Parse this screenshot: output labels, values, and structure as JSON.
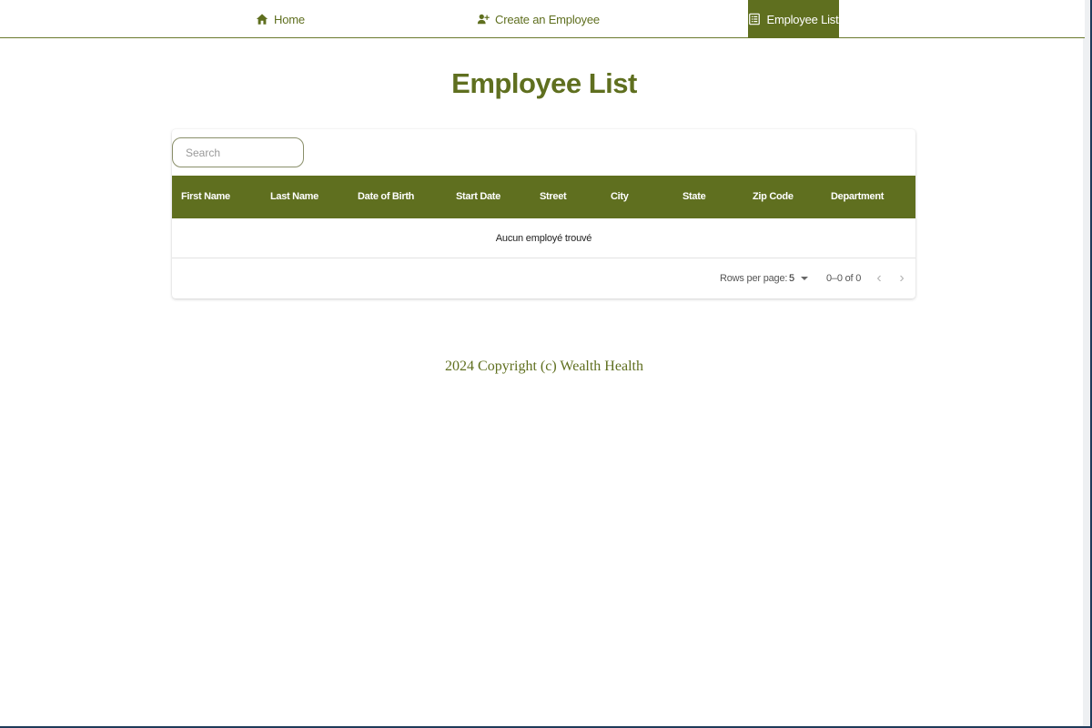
{
  "nav": {
    "home_label": "Home",
    "create_label": "Create an Employee",
    "list_label": "Employee List",
    "active": "Employee List"
  },
  "page": {
    "title": "Employee List"
  },
  "table": {
    "search_placeholder": "Search",
    "columns": [
      "First Name",
      "Last Name",
      "Date of Birth",
      "Start Date",
      "Street",
      "City",
      "State",
      "Zip Code",
      "Department"
    ],
    "empty_message": "Aucun employé trouvé",
    "rows": []
  },
  "pagination": {
    "rows_per_page_label": "Rows per page:",
    "rows_per_page_value": "5",
    "range_label": "0–0 of 0"
  },
  "footer": {
    "text": "2024 Copyright (c) Wealth Health"
  },
  "colors": {
    "accent": "#5f6f1f",
    "text_on_accent": "#ffffff"
  },
  "icons": {
    "home": "home-icon",
    "create": "user-plus-icon",
    "list": "list-icon",
    "prev": "chevron-left-icon",
    "next": "chevron-right-icon"
  }
}
